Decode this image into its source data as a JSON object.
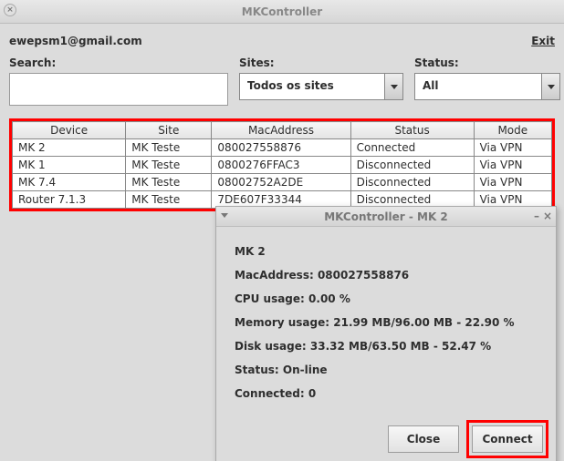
{
  "window": {
    "title": "MKController"
  },
  "header": {
    "user_email": "ewepsm1@gmail.com",
    "exit_label": "Exit"
  },
  "filters": {
    "search": {
      "label": "Search:",
      "value": ""
    },
    "sites": {
      "label": "Sites:",
      "value": "Todos os sites"
    },
    "status": {
      "label": "Status:",
      "value": "All"
    }
  },
  "table": {
    "columns": [
      "Device",
      "Site",
      "MacAddress",
      "Status",
      "Mode"
    ],
    "rows": [
      {
        "device": "MK 2",
        "site": "MK Teste",
        "mac": "080027558876",
        "status": "Connected",
        "mode": "Via VPN"
      },
      {
        "device": "MK 1",
        "site": "MK Teste",
        "mac": "0800276FFAC3",
        "status": "Disconnected",
        "mode": "Via VPN"
      },
      {
        "device": "MK 7.4",
        "site": "MK Teste",
        "mac": "08002752A2DE",
        "status": "Disconnected",
        "mode": "Via VPN"
      },
      {
        "device": "Router 7.1.3",
        "site": "MK Teste",
        "mac": "7DE607F33344",
        "status": "Disconnected",
        "mode": "Via VPN"
      }
    ]
  },
  "dialog": {
    "title": "MKController - MK 2",
    "device_name": "MK 2",
    "mac_label": "MacAddress:",
    "mac": "080027558876",
    "cpu_label": "CPU usage:",
    "cpu": "0.00 %",
    "mem_label": "Memory usage:",
    "mem": "21.99 MB/96.00 MB - 22.90 %",
    "disk_label": "Disk usage:",
    "disk": "33.32 MB/63.50 MB - 52.47 %",
    "status_label": "Status:",
    "status": "On-line",
    "connected_label": "Connected:",
    "connected": "0",
    "close_label": "Close",
    "connect_label": "Connect"
  }
}
